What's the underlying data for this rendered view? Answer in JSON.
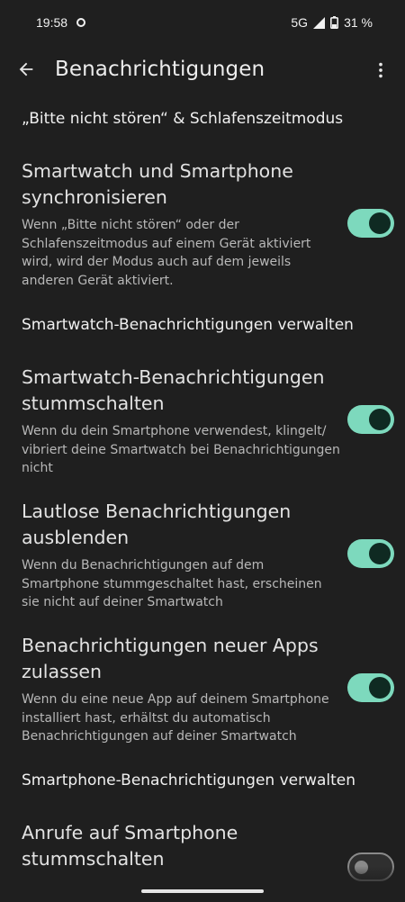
{
  "status_bar": {
    "time": "19:58",
    "network": "5G",
    "battery": "31 %"
  },
  "app_bar": {
    "title": "Benachrichtigungen",
    "back_icon": "arrow-back-icon",
    "more_icon": "more-vert-icon"
  },
  "sections": {
    "dnd_header": "„Bitte nicht stören“ & Schlafenszeitmodus",
    "watch_header": "Smartwatch-Benachrichtigungen verwalten",
    "phone_header": "Smartphone-Benachrichtigungen verwalten"
  },
  "settings": [
    {
      "title": "Smartwatch und Smartphone synchronisieren",
      "desc": "Wenn „Bitte nicht stören“ oder der Schlafenszeitmodus auf einem Gerät aktiviert wird, wird der Modus auch auf dem jeweils anderen Gerät aktiviert.",
      "enabled": true
    },
    {
      "title": "Smartwatch-Benachrichtigungen stummschalten",
      "desc": "Wenn du dein Smartphone verwendest, klingelt/ vibriert deine Smartwatch bei Benachrichtigungen nicht",
      "enabled": true
    },
    {
      "title": "Lautlose Benachrichtigungen ausblenden",
      "desc": "Wenn du Benachrichtigungen auf dem Smartphone stummgeschaltet hast, erscheinen sie nicht auf deiner Smartwatch",
      "enabled": true
    },
    {
      "title": "Benachrichtigungen neuer Apps zulassen",
      "desc": "Wenn du eine neue App auf deinem Smartphone installiert hast, erhältst du automatisch Benachrichtigungen auf deiner Smartwatch",
      "enabled": true
    },
    {
      "title": "Anrufe auf Smartphone stummschalten",
      "desc": "",
      "enabled": false
    }
  ],
  "colors": {
    "background": "#1f1f1f",
    "toggle_on": "#7dd9bd",
    "toggle_knob_on": "#0f2a22",
    "toggle_off_border": "#8a8a8a"
  }
}
